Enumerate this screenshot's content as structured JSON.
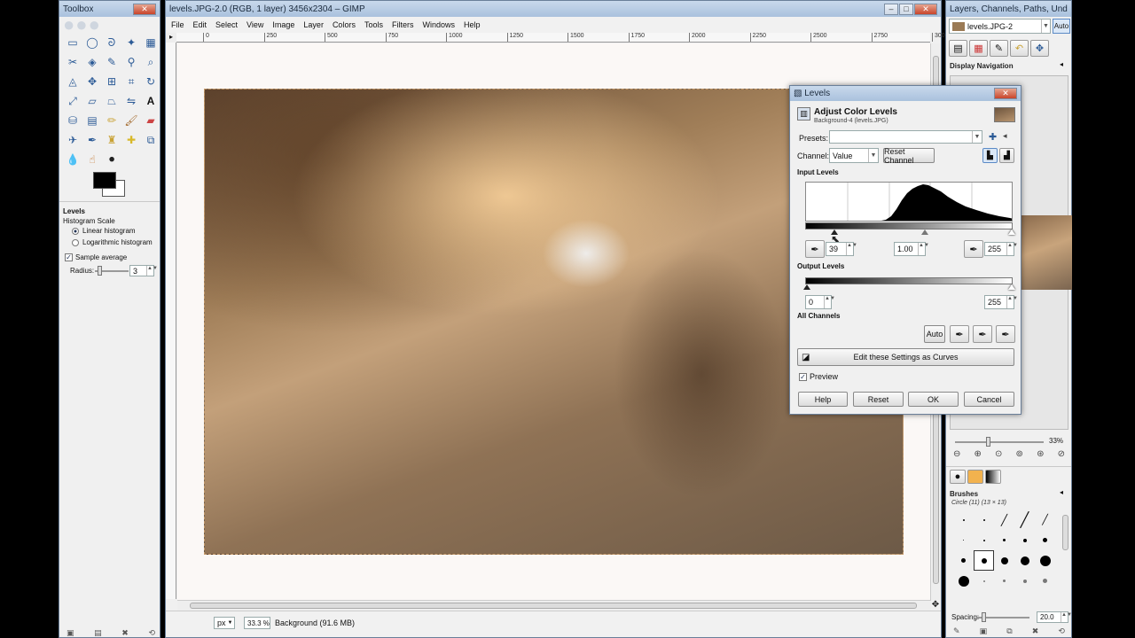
{
  "toolbox": {
    "title": "Toolbox",
    "logo": "●●●",
    "tool_options_title": "Levels",
    "histogram_scale": "Histogram Scale",
    "linear": "Linear histogram",
    "log": "Logarithmic histogram",
    "sample_average": "Sample average",
    "radius_label": "Radius:",
    "radius_value": "3"
  },
  "image_window": {
    "title": "levels.JPG-2.0 (RGB, 1 layer) 3456x2304 – GIMP",
    "menu": [
      "File",
      "Edit",
      "Select",
      "View",
      "Image",
      "Layer",
      "Colors",
      "Tools",
      "Filters",
      "Windows",
      "Help"
    ],
    "ruler_ticks": [
      "0",
      "250",
      "500",
      "750",
      "1000",
      "1250",
      "1500",
      "1750",
      "2000",
      "2250",
      "2500",
      "2750",
      "3000",
      "3250",
      "3500"
    ],
    "unit": "px",
    "zoom": "33.3 %",
    "status": "Background (91.6 MB)"
  },
  "dock": {
    "title": "Layers, Channels, Paths, Undo, N...",
    "image_select": "levels.JPG-2",
    "auto": "Auto",
    "nav_title": "Display Navigation",
    "zoom_pct": "33%",
    "brushes_title": "Brushes",
    "brush_name": "Circle (11) (13 × 13)",
    "spacing_label": "Spacing:",
    "spacing_value": "20.0"
  },
  "levels": {
    "title": "Levels",
    "heading": "Adjust Color Levels",
    "subheading": "Background-4 (levels.JPG)",
    "presets_label": "Presets:",
    "channel_label": "Channel:",
    "channel_value": "Value",
    "reset_channel": "Reset Channel",
    "input_levels": "Input Levels",
    "input_low": "39",
    "gamma": "1.00",
    "input_high": "255",
    "output_levels": "Output Levels",
    "output_low": "0",
    "output_high": "255",
    "all_channels": "All Channels",
    "auto": "Auto",
    "curves": "Edit these Settings as Curves",
    "preview": "Preview",
    "help": "Help",
    "reset": "Reset",
    "ok": "OK",
    "cancel": "Cancel"
  }
}
